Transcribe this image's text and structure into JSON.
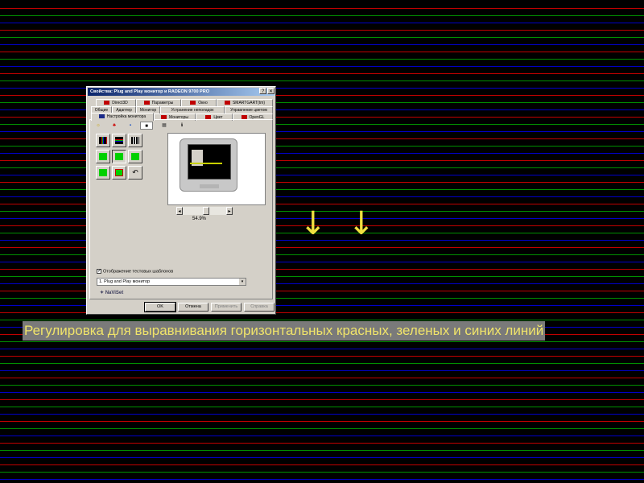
{
  "background_line_colors": [
    "#c00000",
    "#009000",
    "#0000c8"
  ],
  "dialog": {
    "title": "Свойства: Plug and Play монитор и RADEON 9700 PRO",
    "help_glyph": "?",
    "close_glyph": "✕",
    "tabs_row1": [
      "Direct3D",
      "Параметры",
      "Окно",
      "SMARTGART(tm)"
    ],
    "tabs_row2": [
      "Общие",
      "Адаптер",
      "Монитор",
      "Устранение неполадок",
      "Управление цветом"
    ],
    "tabs_row3": [
      "Настройка монитора",
      "Мониторы",
      "Цвет",
      "OpenGL"
    ],
    "active_tab": "Настройка монитора",
    "toolbar_icons": [
      "sun-icon",
      "color-icon",
      "grid-icon",
      "monitor-icon",
      "pattern-icon",
      "info-icon"
    ],
    "toolbar_glyphs": [
      "☼",
      "♣",
      "▪",
      "■",
      "▦",
      "ℹ"
    ],
    "slider": {
      "left_arrow": "◂",
      "right_arrow": "▸",
      "value": "54.9%",
      "level": 0.549
    },
    "checkbox": {
      "label": "Отображение тестовых шаблонов",
      "checked": true,
      "mark": "✓"
    },
    "monitor_select": {
      "value": "1. Plug and Play монитор",
      "arrow": "▾"
    },
    "navi_logo": "NaViSet",
    "buttons": {
      "ok": "OK",
      "cancel": "Отмена",
      "apply": "Применить",
      "help": "Справка"
    }
  },
  "arrows": [
    "↓",
    "↓"
  ],
  "caption": "Регулировка для выравнивания горизонтальных красных, зеленых и синих линий"
}
